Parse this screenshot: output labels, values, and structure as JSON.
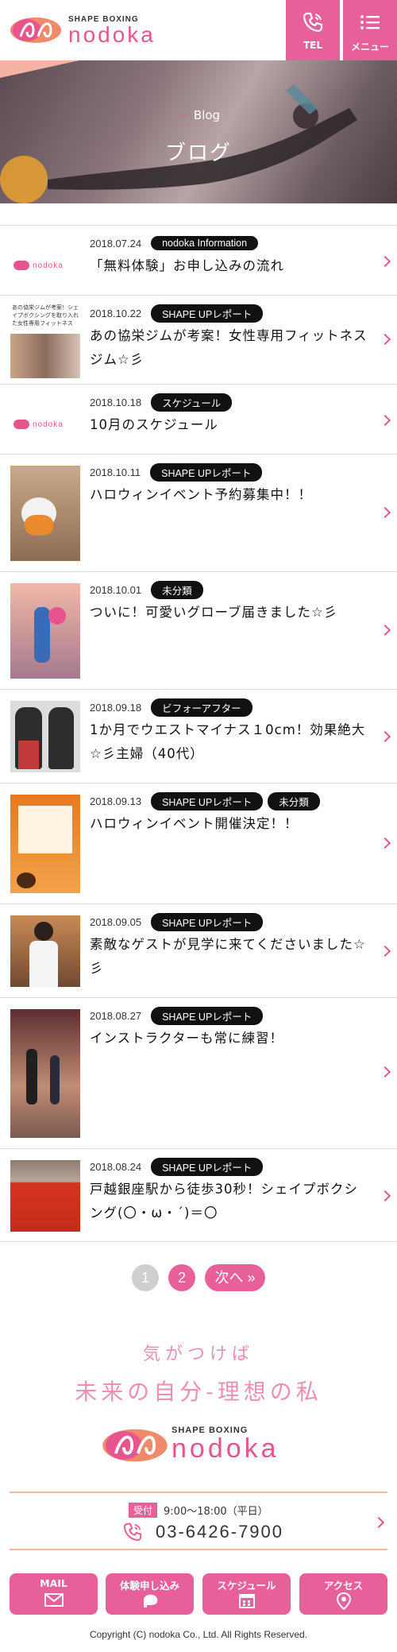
{
  "header": {
    "brand_small": "SHAPE BOXING",
    "brand_big": "nodoka",
    "tel_label": "TEL",
    "menu_label": "メニュー",
    "accent_color": "#e8609a"
  },
  "hero": {
    "subtitle": "Blog",
    "title": "ブログ"
  },
  "posts": [
    {
      "date": "2018.07.24",
      "tags": [
        "nodoka Information"
      ],
      "title": "「無料体験」お申し込みの流れ",
      "thumb": "logo"
    },
    {
      "date": "2018.10.22",
      "tags": [
        "SHAPE UPレポート"
      ],
      "title": "あの協栄ジムが考案！女性専用フィットネスジム☆彡",
      "thumb": "article"
    },
    {
      "date": "2018.10.18",
      "tags": [
        "スケジュール"
      ],
      "title": "10月のスケジュール",
      "thumb": "logo"
    },
    {
      "date": "2018.10.11",
      "tags": [
        "SHAPE UPレポート"
      ],
      "title": "ハロウィンイベント予約募集中！！",
      "thumb": "pumpkin"
    },
    {
      "date": "2018.10.01",
      "tags": [
        "未分類"
      ],
      "title": "ついに！可愛いグローブ届きました☆彡",
      "thumb": "glove"
    },
    {
      "date": "2018.09.18",
      "tags": [
        "ビフォーアフター"
      ],
      "title": "1か月でウエストマイナス１0cm！効果絶大☆彡主婦（40代）",
      "thumb": "beforeafter"
    },
    {
      "date": "2018.09.13",
      "tags": [
        "SHAPE UPレポート",
        "未分類"
      ],
      "title": "ハロウィンイベント開催決定！！",
      "thumb": "flyer"
    },
    {
      "date": "2018.09.05",
      "tags": [
        "SHAPE UPレポート"
      ],
      "title": "素敵なゲストが見学に来てくださいました☆彡",
      "thumb": "guest"
    },
    {
      "date": "2018.08.27",
      "tags": [
        "SHAPE UPレポート"
      ],
      "title": "インストラクターも常に練習！",
      "thumb": "studio"
    },
    {
      "date": "2018.08.24",
      "tags": [
        "SHAPE UPレポート"
      ],
      "title": "戸越銀座駅から徒歩30秒！シェイプボクシング(〇・ω・´)＝〇",
      "thumb": "floor"
    }
  ],
  "pagination": {
    "page1": "1",
    "page2": "2",
    "next": "次へ »",
    "current": 2
  },
  "footer": {
    "catch1": "気がつけば",
    "catch2": "未来の自分-理想の私",
    "brand_small": "SHAPE BOXING",
    "brand_big": "nodoka",
    "reception_label": "受付",
    "hours": "9:00～18:00（平日）",
    "phone": "03-6426-7900",
    "buttons": [
      {
        "label": "MAIL",
        "icon": "mail-icon"
      },
      {
        "label": "体験申し込み",
        "icon": "glove-icon"
      },
      {
        "label": "スケジュール",
        "icon": "calendar-icon"
      },
      {
        "label": "アクセス",
        "icon": "map-pin-icon"
      }
    ],
    "copyright": "Copyright (C) nodoka Co., Ltd. All Rights Reserved."
  }
}
